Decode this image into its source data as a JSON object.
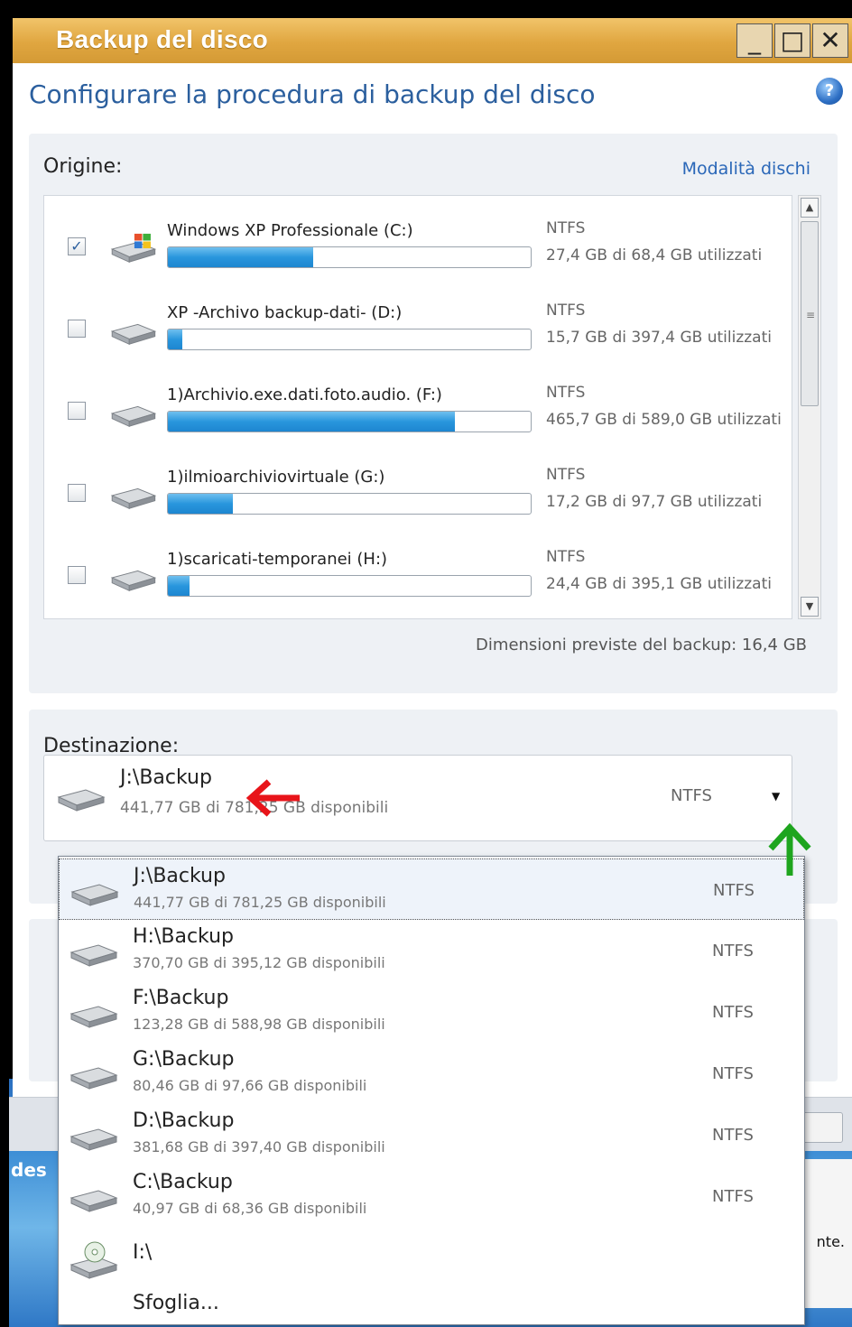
{
  "window": {
    "title": "Backup del disco",
    "controls": {
      "minimize": "_",
      "maximize": "□",
      "close": "✕"
    }
  },
  "subtitle": "Configurare la procedura di backup del disco",
  "origin": {
    "label": "Origine:",
    "mode_link": "Modalità dischi",
    "disks": [
      {
        "name": "Windows XP Professionale (C:)",
        "fs": "NTFS",
        "usage": "27,4 GB di 68,4 GB utilizzati",
        "checked": true,
        "used_fraction": 0.4,
        "icon": "windows-drive-icon"
      },
      {
        "name": "XP -Archivo backup-dati- (D:)",
        "fs": "NTFS",
        "usage": "15,7 GB di 397,4 GB utilizzati",
        "checked": false,
        "used_fraction": 0.04,
        "icon": "hard-drive-icon"
      },
      {
        "name": "1)Archivio.exe.dati.foto.audio. (F:)",
        "fs": "NTFS",
        "usage": "465,7 GB di 589,0 GB utilizzati",
        "checked": false,
        "used_fraction": 0.79,
        "icon": "hard-drive-icon"
      },
      {
        "name": "1)ilmioarchiviovirtuale (G:)",
        "fs": "NTFS",
        "usage": "17,2 GB di 97,7 GB utilizzati",
        "checked": false,
        "used_fraction": 0.18,
        "icon": "hard-drive-icon"
      },
      {
        "name": "1)scaricati-temporanei (H:)",
        "fs": "NTFS",
        "usage": "24,4 GB di 395,1 GB utilizzati",
        "checked": false,
        "used_fraction": 0.06,
        "icon": "hard-drive-icon"
      }
    ],
    "estimated_size": "Dimensioni previste del backup: 16,4 GB"
  },
  "destination": {
    "label": "Destinazione:",
    "selected": {
      "path": "J:\\Backup",
      "free": "441,77 GB di 781,25 GB disponibili",
      "fs": "NTFS"
    },
    "options": [
      {
        "path": "J:\\Backup",
        "free": "441,77 GB di 781,25 GB disponibili",
        "fs": "NTFS"
      },
      {
        "path": "H:\\Backup",
        "free": "370,70 GB di 395,12 GB disponibili",
        "fs": "NTFS"
      },
      {
        "path": "F:\\Backup",
        "free": "123,28 GB di 588,98 GB disponibili",
        "fs": "NTFS"
      },
      {
        "path": "G:\\Backup",
        "free": "80,46 GB di 97,66 GB disponibili",
        "fs": "NTFS"
      },
      {
        "path": "D:\\Backup",
        "free": "381,68 GB di 397,40 GB disponibili",
        "fs": "NTFS"
      },
      {
        "path": "C:\\Backup",
        "free": "40,97 GB di 68,36 GB disponibili",
        "fs": "NTFS"
      }
    ],
    "cd_drive": "I:\\",
    "browse": "Sfoglia..."
  },
  "background": {
    "desktop_label": "des",
    "panel_text": "nte."
  },
  "colors": {
    "titlebar": "#e0a640",
    "subtitle": "#2b5f9e",
    "bar_fill": "#2996dd",
    "annotation_red": "#e8141a",
    "annotation_green": "#1ea51e"
  }
}
